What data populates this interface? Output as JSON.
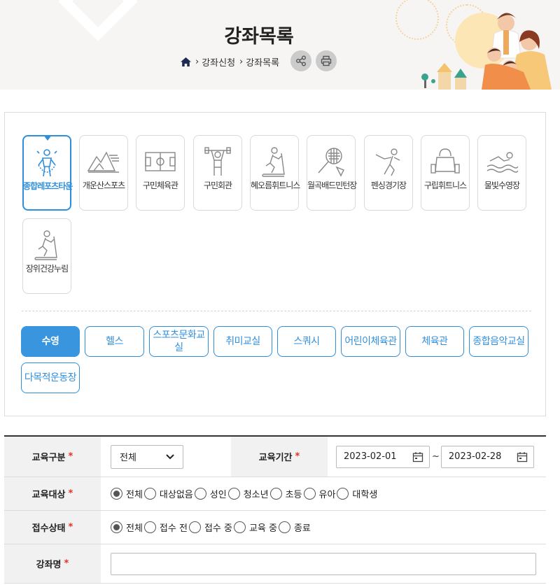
{
  "header": {
    "title": "강좌목록",
    "breadcrumb": [
      "강좌신청",
      "강좌목록"
    ]
  },
  "facilities": [
    {
      "label": "종합레포츠타운",
      "icon": "jump-rope-icon",
      "active": true
    },
    {
      "label": "개운산스포츠",
      "icon": "mountain-icon",
      "active": false
    },
    {
      "label": "구민체육관",
      "icon": "court-icon",
      "active": false
    },
    {
      "label": "구민회관",
      "icon": "weightlifter-icon",
      "active": false
    },
    {
      "label": "혜오름휘트니스",
      "icon": "treadmill-icon",
      "active": false
    },
    {
      "label": "월곡배드민턴장",
      "icon": "badminton-icon",
      "active": false
    },
    {
      "label": "펜싱경기장",
      "icon": "fencing-icon",
      "active": false
    },
    {
      "label": "구립휘트니스",
      "icon": "kettlebell-icon",
      "active": false
    },
    {
      "label": "물빛수영장",
      "icon": "swimmer-icon",
      "active": false
    },
    {
      "label": "장위건강누림",
      "icon": "treadmill-icon",
      "active": false
    }
  ],
  "categories": [
    {
      "label": "수영",
      "active": true
    },
    {
      "label": "헬스",
      "active": false
    },
    {
      "label": "스포츠문화교실",
      "active": false
    },
    {
      "label": "취미교실",
      "active": false
    },
    {
      "label": "스쿼시",
      "active": false
    },
    {
      "label": "어린이체육관",
      "active": false
    },
    {
      "label": "체육관",
      "active": false
    },
    {
      "label": "종합음악교실",
      "active": false
    },
    {
      "label": "다목적운동장",
      "active": false
    }
  ],
  "form": {
    "required_mark": "*",
    "edu_type_label": "교육구분",
    "edu_type_value": "전체",
    "edu_period_label": "교육기간",
    "date_from": "2023-02-01",
    "date_sep": "~",
    "date_to": "2023-02-28",
    "target_label": "교육대상",
    "target_options": [
      "전체",
      "대상없음",
      "성인",
      "청소년",
      "초등",
      "유아",
      "대학생"
    ],
    "target_selected": "전체",
    "status_label": "접수상태",
    "status_options": [
      "전체",
      "접수 전",
      "접수 중",
      "교육 중",
      "종료"
    ],
    "status_selected": "전체",
    "course_name_label": "강좌명",
    "course_name_value": ""
  },
  "colors": {
    "accent": "#3995de",
    "required": "#e0302a"
  }
}
